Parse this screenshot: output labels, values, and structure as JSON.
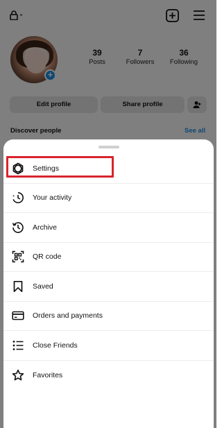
{
  "profile": {
    "stats": [
      {
        "value": "39",
        "label": "Posts"
      },
      {
        "value": "7",
        "label": "Followers"
      },
      {
        "value": "36",
        "label": "Following"
      }
    ],
    "edit_profile_label": "Edit profile",
    "share_profile_label": "Share profile",
    "discover_label": "Discover people",
    "see_all_label": "See all"
  },
  "menu": {
    "items": [
      {
        "label": "Settings",
        "icon": "settings-gear-icon"
      },
      {
        "label": "Your activity",
        "icon": "activity-icon"
      },
      {
        "label": "Archive",
        "icon": "archive-icon"
      },
      {
        "label": "QR code",
        "icon": "qr-code-icon"
      },
      {
        "label": "Saved",
        "icon": "bookmark-icon"
      },
      {
        "label": "Orders and payments",
        "icon": "card-icon"
      },
      {
        "label": "Close Friends",
        "icon": "list-icon"
      },
      {
        "label": "Favorites",
        "icon": "star-icon"
      }
    ],
    "highlighted_item": "Settings"
  },
  "colors": {
    "highlight": "#d9232d",
    "link_blue": "#1d8fe6",
    "overlay": "rgba(0,0,0,0.5)"
  }
}
